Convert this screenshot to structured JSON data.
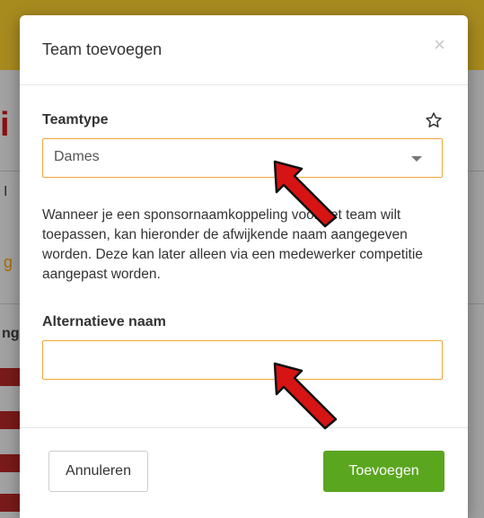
{
  "background": {
    "fragment_1": "I",
    "fragment_2": "ng",
    "fragment_3": "wi",
    "accent_top": "#a88b1f",
    "accent_red": "#7a1a1a"
  },
  "modal": {
    "title": "Team toevoegen",
    "close_label": "×",
    "team_type": {
      "label": "Teamtype",
      "selected_value": "Dames",
      "options": [
        "Dames"
      ]
    },
    "help_text": "Wanneer je een sponsornaamkoppeling voor het team wilt toepassen, kan hieronder de afwijkende naam aangegeven worden. Deze kan later alleen via een medewerker competitie aangepast worden.",
    "alt_name": {
      "label": "Alternatieve naam",
      "value": "",
      "placeholder": ""
    },
    "cancel_label": "Annuleren",
    "add_label": "Toevoegen"
  },
  "colors": {
    "input_border": "#f0a63a",
    "primary_button": "#5aa61f",
    "annotation_arrow": "#d61414"
  },
  "icons": {
    "favorite": "star-icon",
    "close": "close-icon",
    "dropdown": "chevron-down-icon"
  }
}
